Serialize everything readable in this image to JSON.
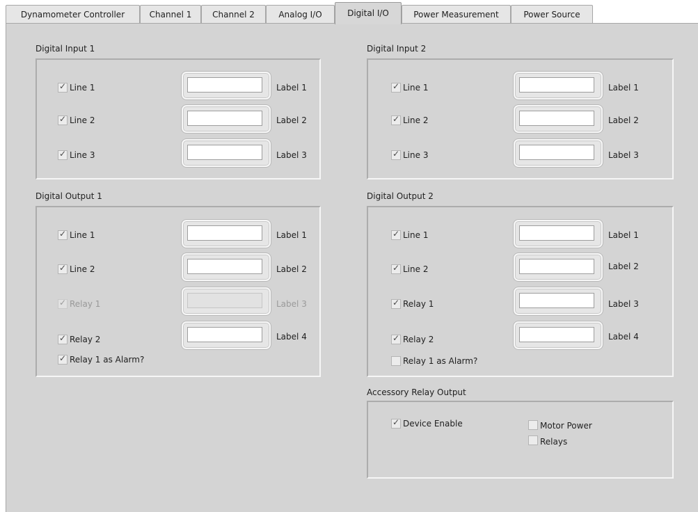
{
  "tabs": [
    "Dynamometer Controller",
    "Channel 1",
    "Channel 2",
    "Analog I/O",
    "Digital I/O",
    "Power Measurement",
    "Power Source"
  ],
  "active_tab": "Digital I/O",
  "groups": {
    "digital_input_1": {
      "title": "Digital Input 1",
      "rows": [
        {
          "check": "Line 1",
          "checked": true,
          "enabled": true,
          "value": "",
          "label": "Label 1"
        },
        {
          "check": "Line 2",
          "checked": true,
          "enabled": true,
          "value": "",
          "label": "Label 2"
        },
        {
          "check": "Line 3",
          "checked": true,
          "enabled": true,
          "value": "",
          "label": "Label 3"
        }
      ]
    },
    "digital_input_2": {
      "title": "Digital Input 2",
      "rows": [
        {
          "check": "Line 1",
          "checked": true,
          "enabled": true,
          "value": "",
          "label": "Label 1"
        },
        {
          "check": "Line 2",
          "checked": true,
          "enabled": true,
          "value": "",
          "label": "Label 2"
        },
        {
          "check": "Line 3",
          "checked": true,
          "enabled": true,
          "value": "",
          "label": "Label 3"
        }
      ]
    },
    "digital_output_1": {
      "title": "Digital Output 1",
      "rows": [
        {
          "check": "Line 1",
          "checked": true,
          "enabled": true,
          "value": "",
          "label": "Label 1"
        },
        {
          "check": "Line 2",
          "checked": true,
          "enabled": true,
          "value": "",
          "label": "Label 2"
        },
        {
          "check": "Relay 1",
          "checked": true,
          "enabled": false,
          "value": "",
          "label": "Label 3"
        },
        {
          "check": "Relay 2",
          "checked": true,
          "enabled": true,
          "value": "",
          "label": "Label 4"
        }
      ],
      "alarm": {
        "label": "Relay 1 as Alarm?",
        "checked": true
      }
    },
    "digital_output_2": {
      "title": "Digital Output 2",
      "rows": [
        {
          "check": "Line 1",
          "checked": true,
          "enabled": true,
          "value": "",
          "label": "Label 1"
        },
        {
          "check": "Line 2",
          "checked": true,
          "enabled": true,
          "value": "",
          "label": "Label 2"
        },
        {
          "check": "Relay 1",
          "checked": true,
          "enabled": true,
          "value": "",
          "label": "Label 3"
        },
        {
          "check": "Relay 2",
          "checked": true,
          "enabled": true,
          "value": "",
          "label": "Label 4"
        }
      ],
      "alarm": {
        "label": "Relay 1 as Alarm?",
        "checked": false
      }
    },
    "accessory_relay_output": {
      "title": "Accessory Relay Output",
      "device_enable": {
        "label": "Device Enable",
        "checked": true
      },
      "motor_power": {
        "label": "Motor Power",
        "checked": false
      },
      "relays": {
        "label": "Relays",
        "checked": false
      }
    }
  }
}
